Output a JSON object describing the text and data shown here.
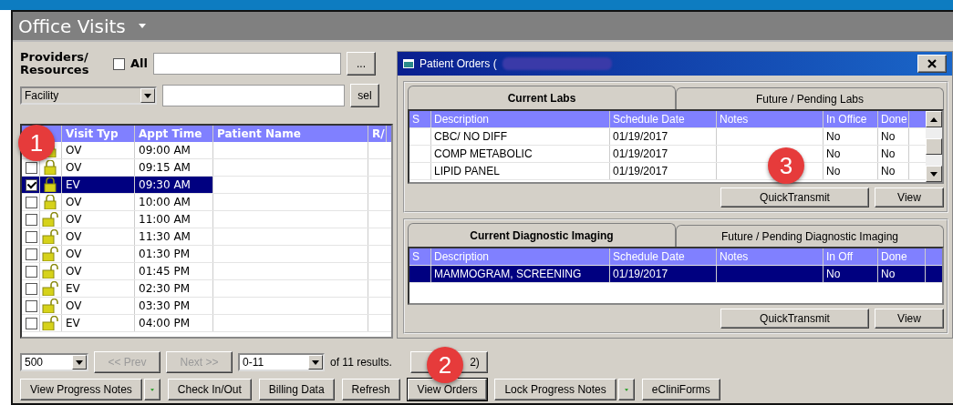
{
  "app_header": {
    "title": "Office Visits"
  },
  "filters": {
    "providers_label": [
      "Providers/",
      "Resources"
    ],
    "all_label": "All",
    "all_checked": false,
    "browse_button": "...",
    "facility_select": "Facility",
    "select_button": "sel"
  },
  "visits": {
    "columns": [
      "Visit Typ",
      "Appt Time",
      "Patient Name",
      "R/"
    ],
    "rows": [
      {
        "locked": true,
        "visit_type": "OV",
        "appt_time": "09:00 AM",
        "selected": false
      },
      {
        "checked": false,
        "locked": true,
        "visit_type": "OV",
        "appt_time": "09:15 AM",
        "selected": false
      },
      {
        "checked": true,
        "locked": true,
        "visit_type": "EV",
        "appt_time": "09:30 AM",
        "selected": true
      },
      {
        "checked": false,
        "locked": true,
        "visit_type": "OV",
        "appt_time": "10:00 AM",
        "selected": false
      },
      {
        "checked": false,
        "locked": false,
        "visit_type": "OV",
        "appt_time": "11:00 AM",
        "selected": false
      },
      {
        "checked": false,
        "locked": false,
        "visit_type": "OV",
        "appt_time": "11:30 AM",
        "selected": false
      },
      {
        "checked": false,
        "locked": false,
        "visit_type": "OV",
        "appt_time": "01:30 PM",
        "selected": false
      },
      {
        "checked": false,
        "locked": false,
        "visit_type": "OV",
        "appt_time": "01:45 PM",
        "selected": false
      },
      {
        "checked": false,
        "locked": false,
        "visit_type": "EV",
        "appt_time": "02:30 PM",
        "selected": false
      },
      {
        "checked": false,
        "locked": false,
        "visit_type": "OV",
        "appt_time": "03:30 PM",
        "selected": false
      },
      {
        "checked": false,
        "locked": false,
        "visit_type": "EV",
        "appt_time": "04:00 PM",
        "selected": false
      }
    ]
  },
  "orders_dialog": {
    "title": "Patient Orders (",
    "groups": [
      {
        "tabs": [
          {
            "label": "Current Labs",
            "selected": true
          },
          {
            "label": "Future / Pending Labs",
            "selected": false
          }
        ],
        "columns": [
          "S",
          "Description",
          "Schedule Date",
          "Notes",
          "In Office",
          "Done"
        ],
        "rows": [
          {
            "description": "CBC/ NO DIFF",
            "schedule_date": "01/19/2017",
            "in_office": "No",
            "done": "No",
            "selected": false
          },
          {
            "description": "COMP METABOLIC",
            "schedule_date": "01/19/2017",
            "in_office": "No",
            "done": "No",
            "selected": false
          },
          {
            "description": "LIPID PANEL",
            "schedule_date": "01/19/2017",
            "in_office": "No",
            "done": "No",
            "selected": false
          }
        ],
        "buttons": [
          "QuickTransmit",
          "View"
        ]
      },
      {
        "tabs": [
          {
            "label": "Current Diagnostic Imaging",
            "selected": true
          },
          {
            "label": "Future / Pending Diagnostic Imaging",
            "selected": false
          }
        ],
        "columns": [
          "S",
          "Description",
          "Schedule Date",
          "Notes",
          "In Off",
          "Done"
        ],
        "rows": [
          {
            "description": "MAMMOGRAM, SCREENING",
            "schedule_date": "01/19/2017",
            "in_office": "No",
            "done": "No",
            "selected": true
          }
        ],
        "buttons": [
          "QuickTransmit",
          "View"
        ]
      }
    ]
  },
  "pagination": {
    "page_size": "500",
    "prev": {
      "label": "<< Prev",
      "disabled": true
    },
    "next": {
      "label": "Next >>",
      "disabled": true
    },
    "range": "0-11",
    "results": "of 11 results.",
    "page_button": "2)"
  },
  "actions": [
    {
      "label": "View Progress Notes",
      "kind": "split"
    },
    {
      "label": "Check In/Out",
      "kind": "plain"
    },
    {
      "label": "Billing Data",
      "kind": "plain"
    },
    {
      "label": "Refresh",
      "kind": "plain"
    },
    {
      "label": "View Orders",
      "kind": "focused"
    },
    {
      "label": "Lock Progress Notes",
      "kind": "split"
    },
    {
      "label": "eCliniForms",
      "kind": "plain"
    }
  ],
  "badges": [
    {
      "label": "1"
    },
    {
      "label": "2"
    },
    {
      "label": "3"
    }
  ]
}
